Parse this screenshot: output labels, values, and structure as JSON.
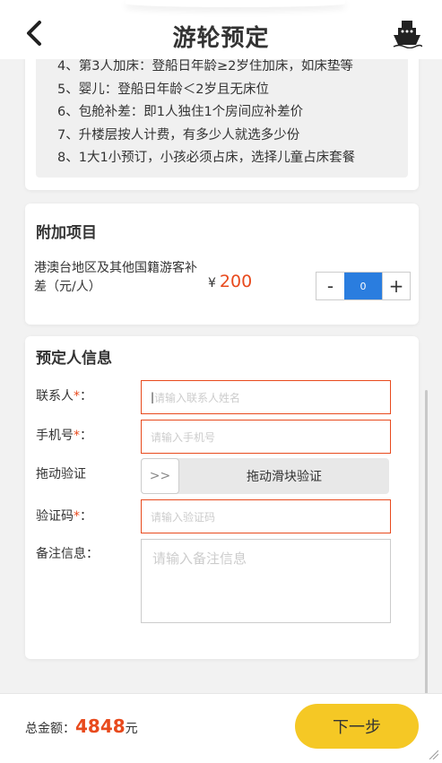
{
  "header": {
    "title": "游轮预定",
    "back_icon": "chevron-left-icon",
    "ship_icon": "ship-icon"
  },
  "notes": [
    "4、第3人加床：登船日年龄≥2岁住加床，如床垫等",
    "5、婴儿：登船日年龄＜2岁且无床位",
    "6、包舱补差：即1人独住1个房间应补差价",
    "7、升楼层按人计费，有多少人就选多少份",
    "8、1大1小预订，小孩必须占床，选择儿童占床套餐"
  ],
  "addon": {
    "title": "附加项目",
    "item_label": "港澳台地区及其他国籍游客补差（元/人）",
    "currency": "¥",
    "price": "200",
    "minus": "-",
    "qty": "0",
    "plus": "+"
  },
  "booker": {
    "title": "预定人信息",
    "contact_label": "联系人",
    "contact_placeholder": "请输入联系人姓名",
    "phone_label": "手机号",
    "phone_placeholder": "请输入手机号",
    "drag_label": "拖动验证",
    "slider_handle": ">>",
    "slider_text": "拖动滑块验证",
    "code_label": "验证码",
    "code_placeholder": "请输入验证码",
    "remark_label": "备注信息：",
    "remark_placeholder": "请输入备注信息",
    "required_mark": "*",
    "colon": "："
  },
  "footer": {
    "total_label": "总金额：",
    "total_amount": "4848",
    "unit": "元",
    "next_label": "下一步"
  },
  "colors": {
    "accent": "#e84a1d",
    "stepper": "#2a7ddf",
    "button": "#f5c825"
  }
}
